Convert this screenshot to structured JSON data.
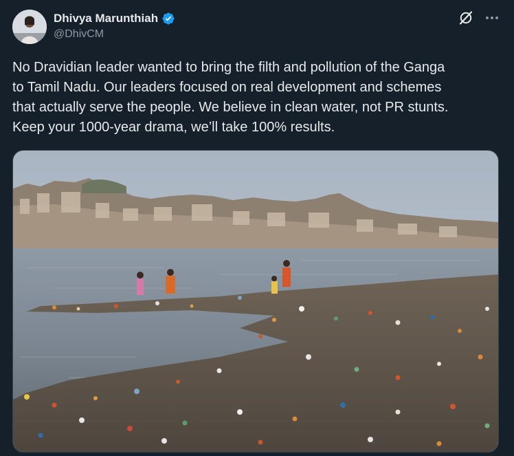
{
  "author": {
    "display_name": "Dhivya Marunthiah",
    "handle": "@DhivCM",
    "verified": true,
    "avatar_icon": "user-avatar"
  },
  "actions": {
    "grok_icon": "grok-icon",
    "more_icon": "more-icon"
  },
  "tweet": {
    "text": "No Dravidian leader wanted to bring the filth and pollution of the Ganga\nto Tamil Nadu. Our leaders focused on real development and schemes\nthat actually serve the people. We believe in clean water, not PR stunts.\nKeep your 1000-year drama, we’ll take 100% results."
  },
  "media": {
    "type": "photo"
  },
  "colors": {
    "background": "#15202b",
    "text": "#e7e9ea",
    "secondary_text": "#8b98a5",
    "verified_badge": "#1d9bf0"
  }
}
